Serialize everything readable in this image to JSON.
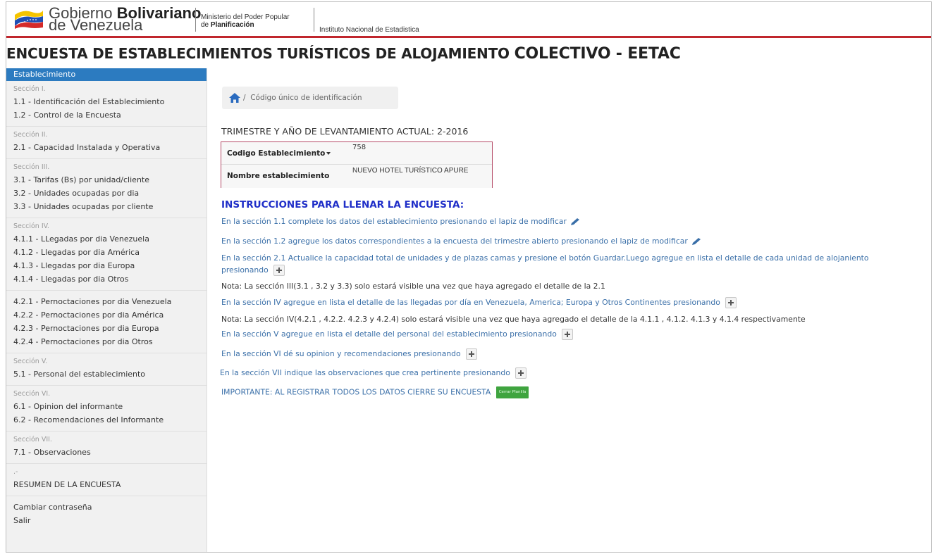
{
  "header": {
    "gobierno_line1_prefix": "Gobierno ",
    "gobierno_line1_bold": "Bolivariano",
    "gobierno_line2": "de Venezuela",
    "ministerio_line1": "Ministerio del Poder Popular",
    "ministerio_line2_prefix": "de ",
    "ministerio_line2_bold": "Planificación",
    "instituto": "Instituto Nacional de Estadistica",
    "accent_color": "#c0262d"
  },
  "page_title": {
    "part1": "ENCUESTA DE ESTABLECIMIENTOS TURÍSTICOS DE ALOJAMIENTO ",
    "part2": "COLECTIVO - EETAC"
  },
  "sidebar": {
    "active": "Establecimiento",
    "groups": [
      {
        "head": "Sección I.",
        "items": [
          "1.1 - Identificación del Establecimiento",
          "1.2 - Control de la Encuesta"
        ]
      },
      {
        "head": "Sección II.",
        "items": [
          "2.1 - Capacidad Instalada y Operativa"
        ]
      },
      {
        "head": "Sección III.",
        "items": [
          "3.1 - Tarifas (Bs) por unidad/cliente",
          "3.2 - Unidades ocupadas por dia",
          "3.3 - Unidades ocupadas por cliente"
        ]
      },
      {
        "head": "Sección IV.",
        "items": [
          "4.1.1 - LLegadas por dia Venezuela",
          "4.1.2 - Llegadas por dia América",
          "4.1.3 - Llegadas por dia Europa",
          "4.1.4 - Llegadas por dia Otros"
        ]
      },
      {
        "head": "",
        "items": [
          "4.2.1 - Pernoctaciones por dia Venezuela",
          "4.2.2 - Pernoctaciones por dia América",
          "4.2.3 - Pernoctaciones por dia Europa",
          "4.2.4 - Pernoctaciones por dia Otros"
        ]
      },
      {
        "head": "Sección V.",
        "items": [
          "5.1 - Personal del establecimiento"
        ]
      },
      {
        "head": "Sección VI.",
        "items": [
          "6.1 - Opinion del informante",
          "6.2 - Recomendaciones del Informante"
        ]
      },
      {
        "head": "Sección VII.",
        "items": [
          "7.1 - Observaciones"
        ]
      },
      {
        "head": ".-",
        "items": [
          "RESUMEN DE LA ENCUESTA"
        ]
      },
      {
        "head": "",
        "items": [
          "Cambiar contraseña",
          "Salir"
        ]
      }
    ],
    "active_color": "#2c7bc0"
  },
  "breadcrumb": {
    "label": "Código único de identificación"
  },
  "trimestre": "TRIMESTRE Y AÑO DE LEVANTAMIENTO ACTUAL: 2-2016",
  "establecimiento": {
    "codigo_label": "Codigo Establecimiento",
    "codigo_value": "758",
    "nombre_label": "Nombre establecimiento",
    "nombre_value": "NUEVO HOTEL TURÍSTICO APURE"
  },
  "instrucciones": {
    "title": "INSTRUCCIONES PARA LLENAR LA ENCUESTA:",
    "l1": "En la sección 1.1 complete los datos del establecimiento presionando el lapiz de modificar",
    "l2": "En la sección 1.2 agregue los datos correspondientes a la encuesta del trimestre abierto presionando el lapiz de modificar",
    "l3a": "En la sección 2.1 Actualice la capacidad total de unidades y de plazas camas y presione el botón Guardar.Luego agregue en lista el detalle de cada unidad de alojaniento",
    "l3b": "presionando",
    "l4": "Nota: La sección III(3.1 , 3.2 y 3.3) solo estará visible una vez que haya agregado el detalle de la 2.1",
    "l5": "En la sección IV agregue en lista el detalle de las llegadas por día en Venezuela, America; Europa y Otros Continentes presionando",
    "l6": "Nota: La sección IV(4.2.1 , 4.2.2. 4.2.3 y 4.2.4) solo estará visible una vez que haya agregado el detalle de la 4.1.1 , 4.1.2. 4.1.3 y 4.1.4 respectivamente",
    "l7": "En la sección V agregue en lista el detalle del personal del establecimiento presionando",
    "l8": "En la sección VI dé su opinion y recomendaciones presionando",
    "l9": "En la sección VII indique las observaciones que crea pertinente presionando",
    "l10": "IMPORTANTE: AL REGISTRAR TODOS LOS DATOS CIERRE SU ENCUESTA",
    "cerrar_button": "Cerrar Planilla",
    "title_color": "#1f2ec8",
    "link_color": "#3a6fa8",
    "button_color": "#3fa43f"
  }
}
